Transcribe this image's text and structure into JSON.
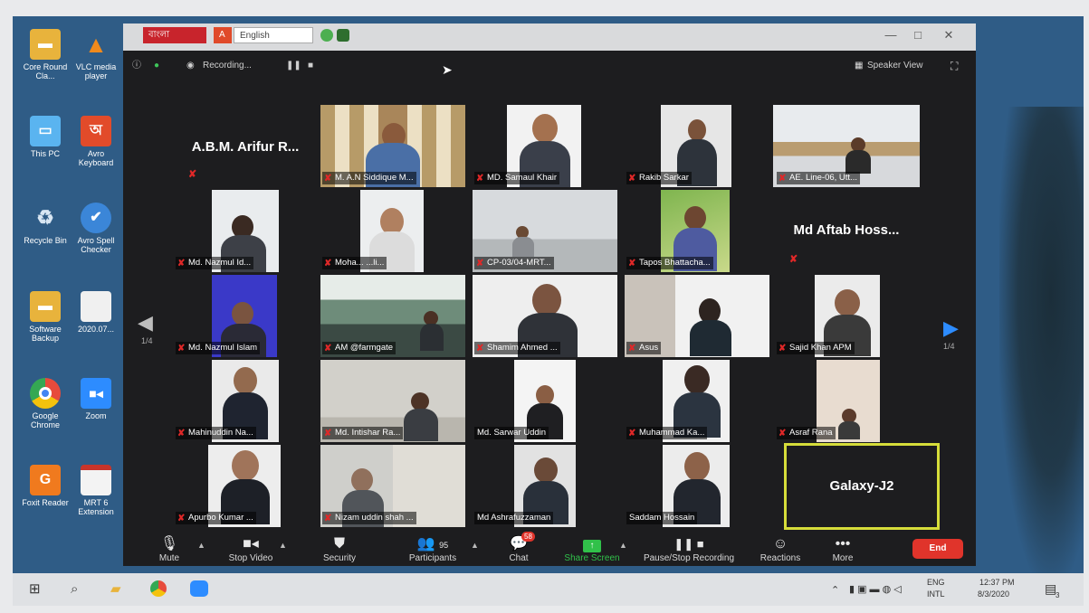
{
  "desktop": {
    "icons": [
      {
        "label": "Core Round Cla..."
      },
      {
        "label": "VLC media player"
      },
      {
        "label": "This PC"
      },
      {
        "label": "Avro Keyboard"
      },
      {
        "label": "Recycle Bin"
      },
      {
        "label": "Avro Spell Checker"
      },
      {
        "label": "Software Backup"
      },
      {
        "label": "2020.07..."
      },
      {
        "label": "Google Chrome"
      },
      {
        "label": "Zoom"
      },
      {
        "label": "Foxit Reader"
      },
      {
        "label": "MRT 6 Extension"
      }
    ]
  },
  "title_bar": {
    "lang_bn": "বাংলা",
    "lang_en": "English",
    "minimize": "—",
    "maximize": "□",
    "close": "✕"
  },
  "top_bar": {
    "recording_label": "Recording...",
    "pause_icon": "❚❚",
    "stop_icon": "■",
    "view_label": "Speaker View"
  },
  "gallery": {
    "page_left": "1/4",
    "page_right": "1/4",
    "tiles": [
      {
        "name": "A.B.M. Arifur R...",
        "video": false
      },
      {
        "name": "M. A.N Siddique M...",
        "video": true
      },
      {
        "name": "MD. Samaul Khair",
        "video": true
      },
      {
        "name": "Rakib Sarkar",
        "video": true
      },
      {
        "name": "AE. Line-06, Utt...",
        "video": true
      },
      {
        "name": "Md. Nazmul Id...",
        "video": true
      },
      {
        "name": "Moha... ...li...",
        "video": true
      },
      {
        "name": "CP-03/04-MRT...",
        "video": true
      },
      {
        "name": "Tapos Bhattacha...",
        "video": true
      },
      {
        "name": "Md Aftab Hoss...",
        "video": false
      },
      {
        "name": "Md. Nazmul Islam",
        "video": true
      },
      {
        "name": "AM @farmgate",
        "video": true
      },
      {
        "name": "Shamim Ahmed ...",
        "video": true
      },
      {
        "name": "Asus",
        "video": true
      },
      {
        "name": "Sajid Khan APM",
        "video": true
      },
      {
        "name": "Mahinuddin Na...",
        "video": true
      },
      {
        "name": "Md. Intishar Ra...",
        "video": true
      },
      {
        "name": "Md. Sarwar Uddin",
        "video": true
      },
      {
        "name": "Muhammad Ka...",
        "video": true
      },
      {
        "name": "Asraf Rana",
        "video": true
      },
      {
        "name": "Apurbo Kumar ...",
        "video": true
      },
      {
        "name": "Nizam uddin shah ...",
        "video": true
      },
      {
        "name": "Md Ashrafuzzaman",
        "video": true
      },
      {
        "name": "Saddam Hossain",
        "video": true
      },
      {
        "name": "Galaxy-J2",
        "video": false,
        "active": true
      }
    ]
  },
  "toolbar": {
    "mute": "Mute",
    "stop_video": "Stop Video",
    "security": "Security",
    "participants": "Participants",
    "participants_count": "95",
    "chat": "Chat",
    "chat_badge": "58",
    "share_screen": "Share Screen",
    "pause_stop_recording": "Pause/Stop Recording",
    "reactions": "Reactions",
    "more": "More",
    "end": "End"
  },
  "taskbar": {
    "lang_top": "ENG",
    "lang_bottom": "INTL",
    "time": "12:37 PM",
    "date": "8/3/2020",
    "notif_count": "3"
  },
  "colors": {
    "active_speaker_border": "#d6dd3a",
    "share_green": "#31c14a",
    "end_red": "#e0342b",
    "nav_blue": "#2d8cff",
    "muted_red": "#e02828"
  }
}
